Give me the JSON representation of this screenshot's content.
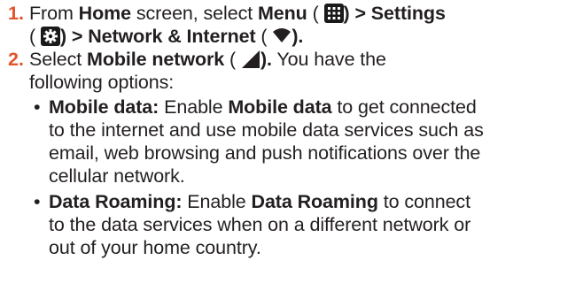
{
  "colors": {
    "accent": "#e2542a",
    "text": "#231f20"
  },
  "steps": [
    {
      "number": "1.",
      "t1": "From ",
      "b_home": "Home",
      "t2": " screen, select ",
      "b_menu": "Menu",
      "t3": " (",
      "t4": ") > Settings",
      "t5": "(",
      "t6": ") > Network & Internet",
      "t7": " (",
      "t8": ")."
    },
    {
      "number": "2.",
      "t1": "Select ",
      "b_mobile": "Mobile network",
      "t2": " (",
      "t3": ").",
      "t4": " You have the",
      "t5": "following options:"
    }
  ],
  "options": [
    {
      "bullet": "•",
      "title": "Mobile data:",
      "t1": " Enable ",
      "b1": "Mobile data",
      "t2": " to get connected",
      "l2": "to the internet and use mobile data services such as",
      "l3": "email, web browsing and push notifications over the",
      "l4": "cellular network."
    },
    {
      "bullet": "•",
      "title": "Data Roaming:",
      "t1": " Enable ",
      "b1": "Data Roaming",
      "t2": " to connect",
      "l2": "to the data services when on a different network or",
      "l3": "out of your home country."
    }
  ],
  "icons": [
    "menu-grid-icon",
    "settings-gear-icon",
    "wifi-icon",
    "mobile-signal-icon"
  ]
}
